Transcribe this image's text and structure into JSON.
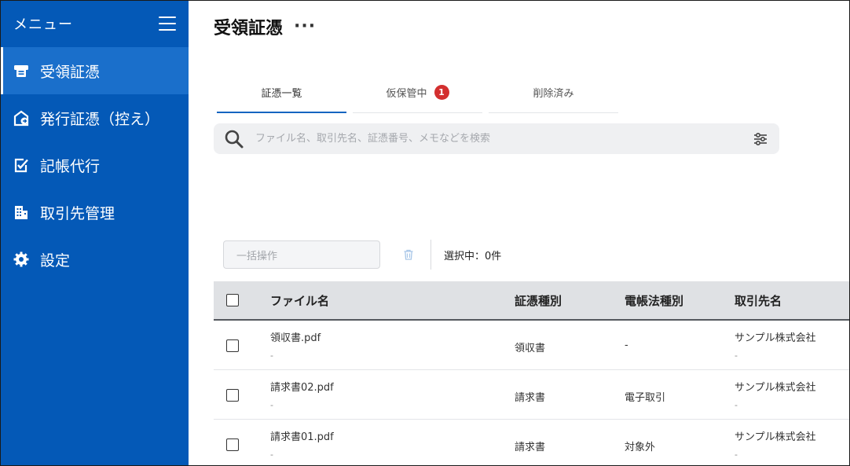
{
  "sidebar": {
    "title": "メニュー",
    "items": [
      {
        "label": "受領証憑",
        "icon": "receipt-in-icon",
        "active": true
      },
      {
        "label": "発行証憑（控え）",
        "icon": "receipt-out-icon",
        "active": false
      },
      {
        "label": "記帳代行",
        "icon": "edit-check-icon",
        "active": false
      },
      {
        "label": "取引先管理",
        "icon": "building-icon",
        "active": false
      },
      {
        "label": "設定",
        "icon": "gear-icon",
        "active": false
      }
    ]
  },
  "header": {
    "title": "受領証憑",
    "more": "···"
  },
  "tabs": [
    {
      "label": "証憑一覧",
      "active": true
    },
    {
      "label": "仮保管中",
      "badge": "1",
      "active": false
    },
    {
      "label": "削除済み",
      "active": false
    }
  ],
  "search": {
    "placeholder": "ファイル名、取引先名、証憑番号、メモなどを検索",
    "value": ""
  },
  "bulk": {
    "select_placeholder": "一括操作",
    "selected_text": "選択中：0件"
  },
  "table": {
    "headers": [
      "ファイル名",
      "証憑種別",
      "電帳法種別",
      "取引先名"
    ],
    "rows": [
      {
        "file": "領収書.pdf",
        "file_sub": "-",
        "type": "領収書",
        "law_type": "-",
        "partner": "サンプル株式会社",
        "partner_sub": "-"
      },
      {
        "file": "請求書02.pdf",
        "file_sub": "-",
        "type": "請求書",
        "law_type": "電子取引",
        "partner": "サンプル株式会社",
        "partner_sub": "-"
      },
      {
        "file": "請求書01.pdf",
        "file_sub": "-",
        "type": "請求書",
        "law_type": "対象外",
        "partner": "サンプル株式会社",
        "partner_sub": "-"
      }
    ]
  },
  "colors": {
    "sidebar": "#0459b7",
    "sidebar_active": "#1a6fcb",
    "accent": "#1565c0",
    "badge": "#d32f2f"
  }
}
